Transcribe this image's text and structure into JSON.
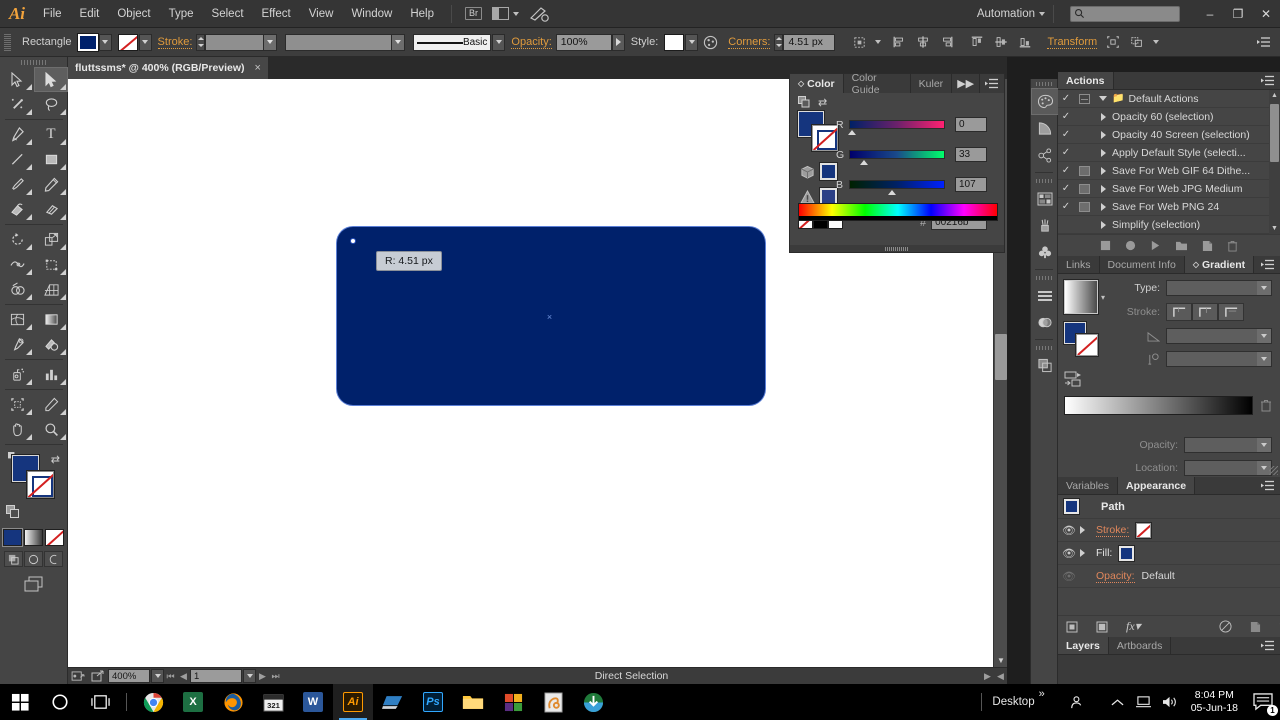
{
  "app": {
    "name": "Adobe Illustrator",
    "logo_text": "Ai"
  },
  "menubar": {
    "items": [
      "File",
      "Edit",
      "Object",
      "Type",
      "Select",
      "Effect",
      "View",
      "Window",
      "Help"
    ],
    "bridge_label": "Br",
    "automation_label": "Automation",
    "search_placeholder": "",
    "search_value": ""
  },
  "window_controls": {
    "minimize": "–",
    "restore": "❐",
    "close": "✕"
  },
  "optionsbar": {
    "tool_name": "Rectangle",
    "stroke_label": "Stroke:",
    "stroke_weight": "",
    "stroke_profile": "",
    "brush_label": "Basic",
    "opacity_label": "Opacity:",
    "opacity_value": "100%",
    "style_label": "Style:",
    "corners_label": "Corners:",
    "corners_value": "4.51 px",
    "transform_label": "Transform"
  },
  "document": {
    "tab_title": "fluttssms* @ 400% (RGB/Preview)",
    "close_glyph": "×"
  },
  "canvas": {
    "shape_fill": "#00216b",
    "selection_color": "#5b7fd6",
    "tooltip_text": "R: 4.51 px",
    "center_marker": "×"
  },
  "statusbar": {
    "zoom": "400%",
    "page": "1",
    "tool_status": "Direct Selection"
  },
  "color_panel": {
    "tabs": [
      {
        "label": "Color",
        "active": true
      },
      {
        "label": "Color Guide",
        "active": false
      },
      {
        "label": "Kuler",
        "active": false
      }
    ],
    "channels": [
      {
        "label": "R",
        "value": "0",
        "knob_pct": 0
      },
      {
        "label": "G",
        "value": "33",
        "knob_pct": 13
      },
      {
        "label": "B",
        "value": "107",
        "knob_pct": 42
      }
    ],
    "hex_symbol": "#",
    "hex_value": "00216b",
    "fill_color": "#15357e"
  },
  "actions_panel": {
    "tab_label": "Actions",
    "rows": [
      {
        "checked": true,
        "box": "dash",
        "expanded": true,
        "label": "Default Actions",
        "is_set": true
      },
      {
        "checked": true,
        "box": "none",
        "expanded": false,
        "label": "Opacity 60 (selection)",
        "is_set": false
      },
      {
        "checked": true,
        "box": "none",
        "expanded": false,
        "label": "Opacity 40 Screen (selection)",
        "is_set": false
      },
      {
        "checked": true,
        "box": "none",
        "expanded": false,
        "label": "Apply Default Style (selecti...",
        "is_set": false
      },
      {
        "checked": true,
        "box": "filled",
        "expanded": false,
        "label": "Save For Web GIF 64 Dithe...",
        "is_set": false
      },
      {
        "checked": true,
        "box": "filled",
        "expanded": false,
        "label": "Save For Web JPG Medium",
        "is_set": false
      },
      {
        "checked": true,
        "box": "filled",
        "expanded": false,
        "label": "Save For Web PNG 24",
        "is_set": false
      },
      {
        "checked": false,
        "box": "none",
        "expanded": false,
        "label": "Simplify (selection)",
        "is_set": false
      }
    ]
  },
  "gradient_panel": {
    "tabs": [
      {
        "label": "Links",
        "active": false
      },
      {
        "label": "Document Info",
        "active": false
      },
      {
        "label": "Gradient",
        "active": true
      }
    ],
    "type_label": "Type:",
    "type_value": "",
    "stroke_label": "Stroke:",
    "angle_value": "",
    "aspect_value": "",
    "opacity_label": "Opacity:",
    "opacity_value": "",
    "location_label": "Location:",
    "location_value": ""
  },
  "appearance_panel": {
    "tabs": [
      {
        "label": "Variables",
        "active": false
      },
      {
        "label": "Appearance",
        "active": true
      }
    ],
    "object_name": "Path",
    "rows": [
      {
        "label": "Stroke:",
        "value": "",
        "swatch": "none",
        "eye": true,
        "arrow": true
      },
      {
        "label": "Fill:",
        "value": "",
        "swatch": "blue",
        "eye": true,
        "arrow": true
      },
      {
        "label": "Opacity:",
        "value": "Default",
        "swatch": "",
        "eye": true,
        "arrow": false
      }
    ]
  },
  "bottom_tabs": [
    {
      "label": "Layers",
      "active": true
    },
    {
      "label": "Artboards",
      "active": false
    }
  ],
  "taskbar": {
    "start_label": "start-icon",
    "apps": [
      {
        "name": "cortana-icon",
        "glyph": "○",
        "color": "#ffffff",
        "bg": "transparent",
        "active": false
      },
      {
        "name": "task-view-icon",
        "glyph": "▢",
        "color": "#ffffff",
        "bg": "transparent",
        "active": false
      },
      {
        "name": "chrome-icon",
        "glyph": "",
        "color": "#ffffff",
        "bg": "#dd4b39",
        "active": false
      },
      {
        "name": "excel-icon",
        "glyph": "X",
        "color": "#ffffff",
        "bg": "#1d6f42",
        "active": false
      },
      {
        "name": "firefox-icon",
        "glyph": "",
        "color": "#ffffff",
        "bg": "#e66000",
        "active": false
      },
      {
        "name": "calendar-icon",
        "glyph": "321",
        "color": "#ffffff",
        "bg": "#3a3a3a",
        "active": false
      },
      {
        "name": "word-icon",
        "glyph": "W",
        "color": "#ffffff",
        "bg": "#2b579a",
        "active": false
      },
      {
        "name": "illustrator-icon",
        "glyph": "Ai",
        "color": "#ff9a00",
        "bg": "#1a1a1a",
        "active": true
      },
      {
        "name": "remote-desktop-icon",
        "glyph": "",
        "color": "#5ea7e8",
        "bg": "transparent",
        "active": false
      },
      {
        "name": "photoshop-icon",
        "glyph": "Ps",
        "color": "#31a8ff",
        "bg": "#001e36",
        "active": false
      },
      {
        "name": "file-explorer-icon",
        "glyph": "",
        "color": "#ffc83d",
        "bg": "transparent",
        "active": false
      },
      {
        "name": "microsoft-store-icon",
        "glyph": "",
        "color": "#ffffff",
        "bg": "transparent",
        "active": false
      },
      {
        "name": "snipping-tool-icon",
        "glyph": "",
        "color": "#f2a33c",
        "bg": "#e8e8e8",
        "active": false
      },
      {
        "name": "idm-icon",
        "glyph": "",
        "color": "#2a9d4a",
        "bg": "transparent",
        "active": false
      }
    ],
    "desktop_label": "Desktop",
    "overflow_glyph": "»",
    "time": "8:04 PM",
    "date": "05-Jun-18",
    "notification_count": "1"
  }
}
